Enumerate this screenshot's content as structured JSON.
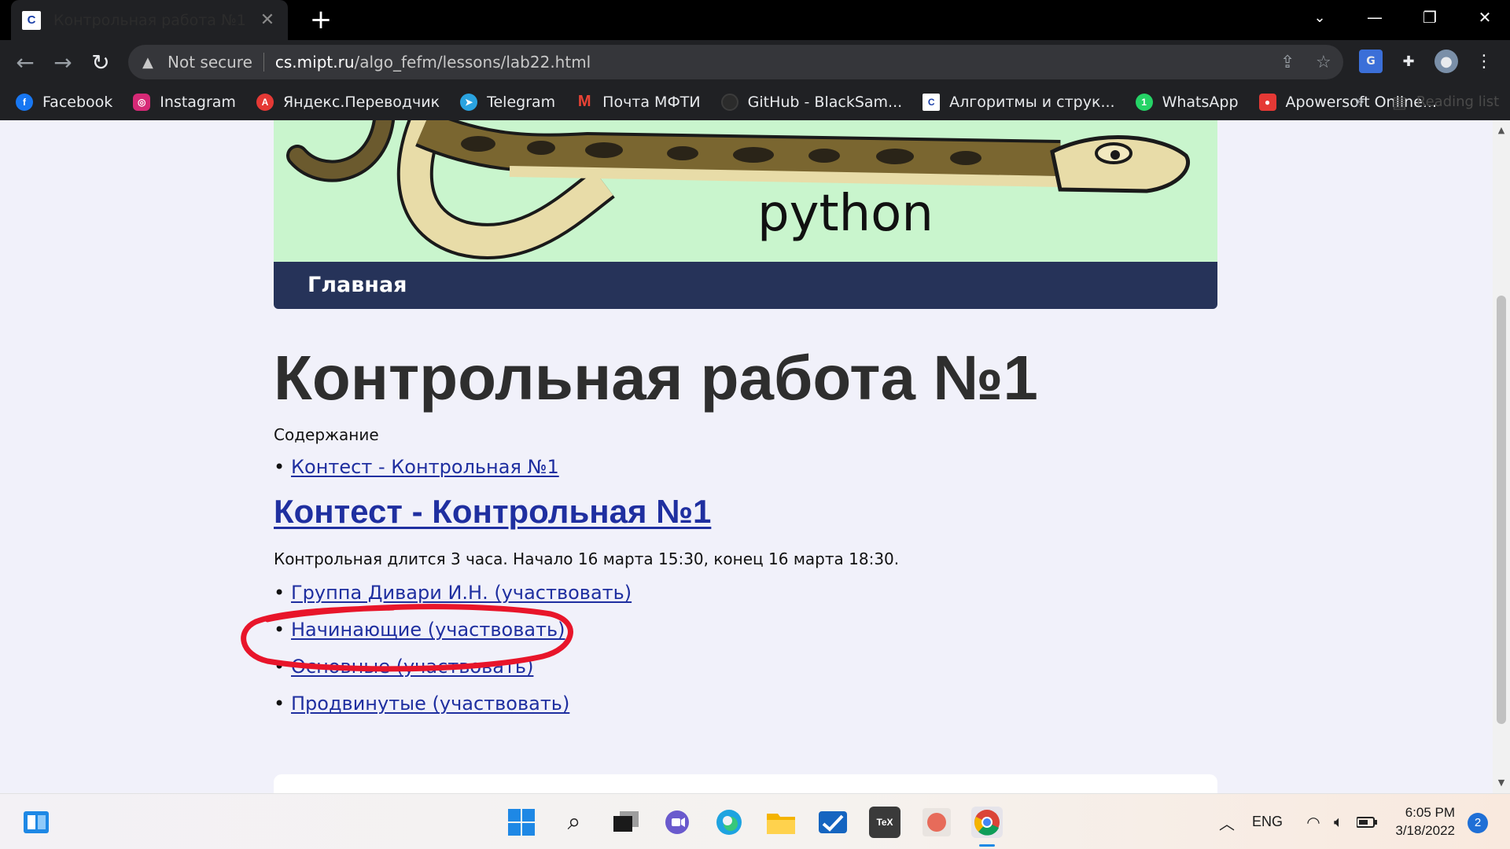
{
  "browser": {
    "tab_title": "Контрольная работа №1",
    "tab_favicon_letter": "C",
    "new_tab": "+",
    "security_label": "Not secure",
    "url_host": "cs.mipt.ru",
    "url_path": "/algo_fefm/lessons/lab22.html",
    "bookmarks": [
      {
        "label": "Facebook",
        "icon": "facebook-icon",
        "color": "#1877f2",
        "glyph": "f"
      },
      {
        "label": "Instagram",
        "icon": "instagram-icon",
        "color": "#d62976",
        "glyph": "◎"
      },
      {
        "label": "Яндекс.Переводчик",
        "icon": "yandex-translate-icon",
        "color": "#e53935",
        "glyph": "A"
      },
      {
        "label": "Telegram",
        "icon": "telegram-icon",
        "color": "#2aa3e0",
        "glyph": "➤"
      },
      {
        "label": "Почта МФТИ",
        "icon": "gmail-icon",
        "color": "#202124",
        "glyph": "M"
      },
      {
        "label": "GitHub - BlackSam...",
        "icon": "github-icon",
        "color": "#2b2b2b",
        "glyph": "●"
      },
      {
        "label": "Алгоритмы и струк...",
        "icon": "c-lang-icon",
        "color": "#ffffff",
        "glyph": "C"
      },
      {
        "label": "WhatsApp",
        "icon": "whatsapp-icon",
        "color": "#25d366",
        "glyph": "1"
      },
      {
        "label": "Apowersoft Online...",
        "icon": "apowersoft-icon",
        "color": "#e53935",
        "glyph": "●"
      }
    ],
    "bookmarks_more": "»",
    "reading_list": "Reading list"
  },
  "page": {
    "nav_home": "Главная",
    "title": "Контрольная работа №1",
    "toc_label": "Содержание",
    "toc_links": [
      "Контест - Контрольная №1"
    ],
    "section_heading": "Контест - Контрольная №1",
    "duration_text": "Контрольная длится 3 часа. Начало 16 марта 15:30, конец 16 марта 18:30.",
    "group_links": [
      "Группа Дивари И.Н. (участвовать)",
      "Начинающие (участвовать)",
      "Основные (участвовать)",
      "Продвинутые (участвовать)"
    ],
    "banner_text": "python"
  },
  "taskbar": {
    "language": "ENG",
    "time": "6:05 PM",
    "date": "3/18/2022",
    "notification_count": "2"
  },
  "colors": {
    "link": "#1f2fa0",
    "nav_bar": "#263359",
    "banner_bg": "#c9f5cd",
    "annotation_red": "#e8152a"
  }
}
